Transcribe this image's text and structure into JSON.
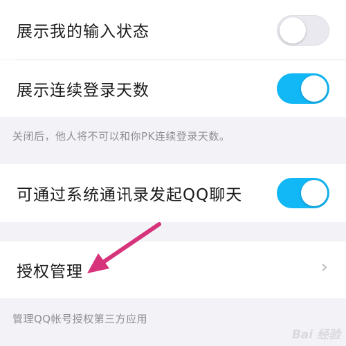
{
  "settings": {
    "typing_status": {
      "label": "展示我的输入状态",
      "enabled": false
    },
    "login_days": {
      "label": "展示连续登录天数",
      "enabled": true
    },
    "login_days_hint": "关闭后，他人将不可以和你PK连续登录天数。",
    "contacts_chat": {
      "label": "可通过系统通讯录发起QQ聊天",
      "enabled": true
    },
    "authorization": {
      "label": "授权管理",
      "chevron": "›"
    },
    "authorization_hint": "管理QQ帐号授权第三方应用"
  },
  "colors": {
    "toggle_on": "#12b7f5",
    "toggle_off": "#e9e9ef",
    "arrow": "#d6337a",
    "background": "#f2f2f7"
  },
  "watermark": "Bai 经验"
}
